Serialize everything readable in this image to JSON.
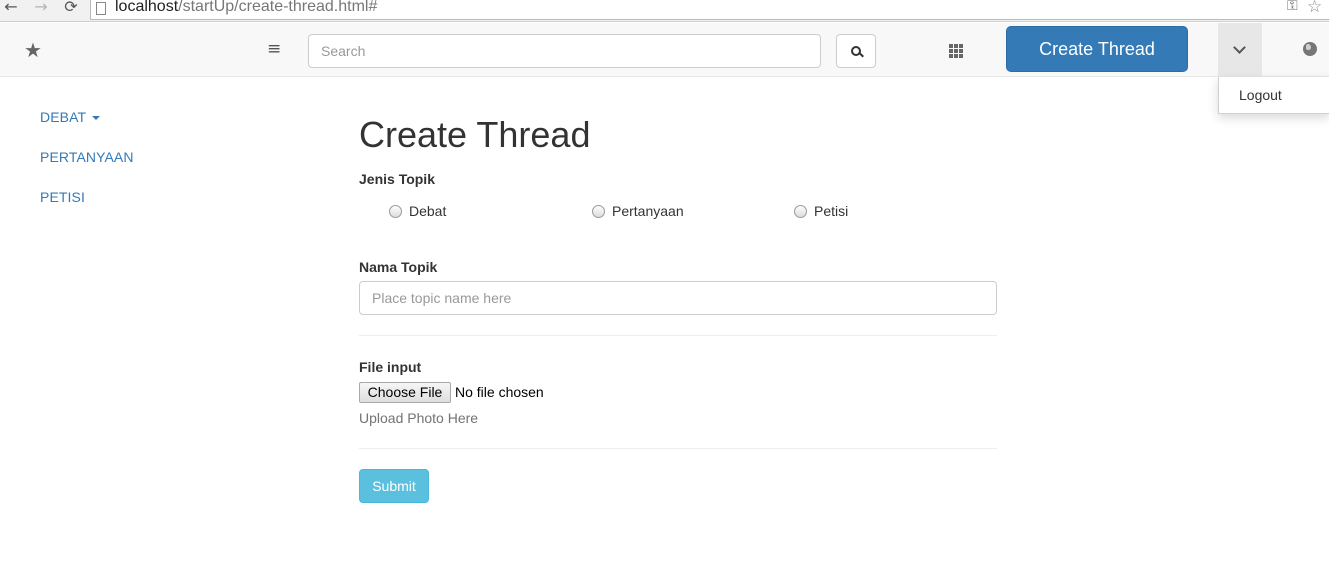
{
  "browser": {
    "back_icon": "←",
    "forward_icon": "→",
    "reload_icon": "⟳",
    "url_host": "localhost",
    "url_path": "/startUp/create-thread.html#",
    "key_icon": "⚿",
    "bookmark_icon": "☆"
  },
  "navbar": {
    "brand_icon": "★",
    "menu_icon": "≡",
    "search_placeholder": "Search",
    "create_button_label": "Create Thread",
    "user_menu": {
      "items": [
        "Logout"
      ]
    }
  },
  "sidebar": {
    "items": [
      {
        "label": "DEBAT",
        "has_caret": true
      },
      {
        "label": "PERTANYAAN"
      },
      {
        "label": "PETISI"
      }
    ]
  },
  "form": {
    "title": "Create Thread",
    "topic_type": {
      "label": "Jenis Topik",
      "options": [
        "Debat",
        "Pertanyaan",
        "Petisi"
      ]
    },
    "topic_name": {
      "label": "Nama Topik",
      "placeholder": "Place topic name here",
      "value": ""
    },
    "file": {
      "label": "File input",
      "button_label": "Choose File",
      "status": "No file chosen",
      "help": "Upload Photo Here"
    },
    "submit_label": "Submit"
  },
  "colors": {
    "primary": "#337ab7",
    "info": "#5bc0de",
    "link": "#337ab7"
  }
}
